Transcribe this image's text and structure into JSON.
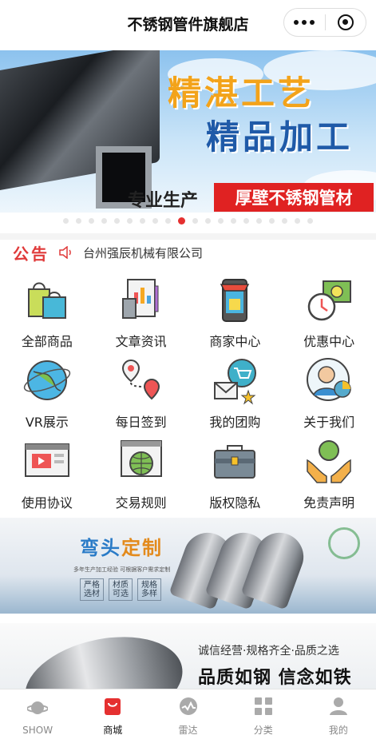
{
  "header": {
    "title": "不锈钢管件旗舰店"
  },
  "banner": {
    "slogan_line1": "精湛工艺",
    "slogan_line2": "精品加工",
    "bar_left": "专业生产",
    "bar_right": "厚壁不锈钢管材",
    "dot_count": 20,
    "active_dot": 9
  },
  "notice": {
    "tag": "公告",
    "text": "台州强辰机械有限公司"
  },
  "grid": [
    {
      "label": "全部商品",
      "icon": "shopping-bags-icon"
    },
    {
      "label": "文章资讯",
      "icon": "article-news-icon"
    },
    {
      "label": "商家中心",
      "icon": "store-phone-icon"
    },
    {
      "label": "优惠中心",
      "icon": "discount-clock-icon"
    },
    {
      "label": "VR展示",
      "icon": "globe-icon"
    },
    {
      "label": "每日签到",
      "icon": "map-pin-route-icon"
    },
    {
      "label": "我的团购",
      "icon": "group-buy-cart-icon"
    },
    {
      "label": "关于我们",
      "icon": "person-chart-icon"
    },
    {
      "label": "使用协议",
      "icon": "video-player-icon"
    },
    {
      "label": "交易规则",
      "icon": "globe-window-icon"
    },
    {
      "label": "版权隐私",
      "icon": "briefcase-icon"
    },
    {
      "label": "免责声明",
      "icon": "hands-globe-icon"
    }
  ],
  "promo1": {
    "title_a": "弯头",
    "title_b": "定制",
    "subtitle": "多年生产加工经验 可根据客户需求定制",
    "chips": [
      "严格\n选材",
      "材质\n可选",
      "规格\n多样"
    ]
  },
  "promo2": {
    "line1": "诚信经营·规格齐全·品质之选",
    "line2": "品质如钢 信念如铁"
  },
  "tabbar": [
    {
      "label": "SHOW",
      "icon": "planet-icon",
      "active": false
    },
    {
      "label": "商城",
      "icon": "shopping-bag-icon",
      "active": true
    },
    {
      "label": "雷达",
      "icon": "radar-pulse-icon",
      "active": false
    },
    {
      "label": "分类",
      "icon": "category-grid-icon",
      "active": false
    },
    {
      "label": "我的",
      "icon": "user-icon",
      "active": false
    }
  ],
  "colors": {
    "accent_red": "#e53030",
    "notice_red": "#e03a3a",
    "blue": "#1f5aa8",
    "orange": "#f3a31a"
  }
}
